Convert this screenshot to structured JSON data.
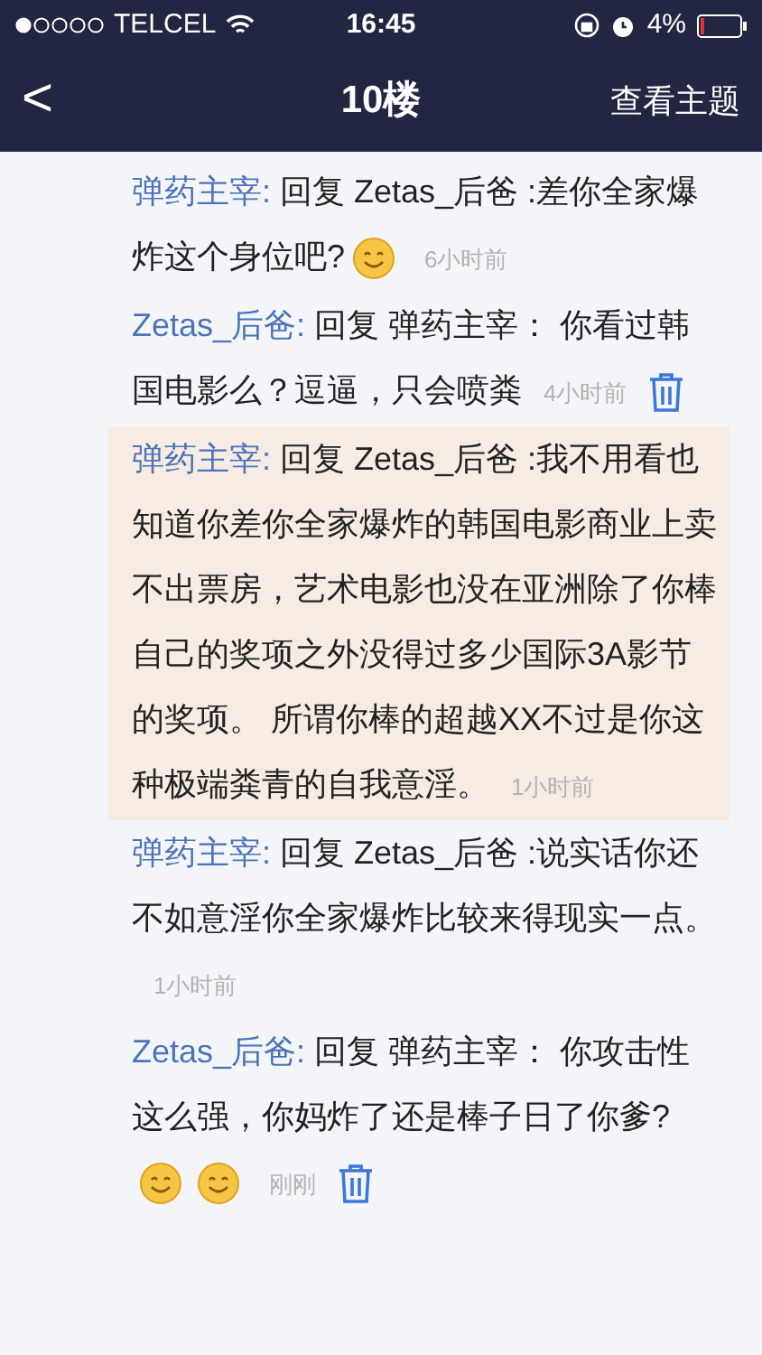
{
  "status_bar": {
    "carrier": "TELCEL",
    "time": "16:45",
    "battery": "4%"
  },
  "nav": {
    "back": "<",
    "title": "10楼",
    "action": "查看主题"
  },
  "comments": [
    {
      "author": "弹药主宰:",
      "text": "回复 Zetas_后爸 :差你全家爆炸这个身位吧?",
      "emojis": [
        {
          "kind": "smile"
        }
      ],
      "time": "6小时前",
      "deletable": false,
      "highlighted": false
    },
    {
      "author": "Zetas_后爸:",
      "text": "回复 弹药主宰： 你看过韩国电影么？逗逼，只会喷粪",
      "time": "4小时前",
      "deletable": true,
      "highlighted": false
    },
    {
      "author": "弹药主宰:",
      "text": "回复 Zetas_后爸 :我不用看也知道你差你全家爆炸的韩国电影商业上卖不出票房，艺术电影也没在亚洲除了你棒自己的奖项之外没得过多少国际3A影节的奖项。 所谓你棒的超越XX不过是你这种极端粪青的自我意淫。",
      "time": "1小时前",
      "deletable": false,
      "highlighted": true
    },
    {
      "author": "弹药主宰:",
      "text": "回复 Zetas_后爸 :说实话你还不如意淫你全家爆炸比较来得现实一点。",
      "time": "1小时前",
      "deletable": false,
      "highlighted": false
    },
    {
      "author": "Zetas_后爸:",
      "text": "回复 弹药主宰： 你攻击性这么强，你妈炸了还是棒子日了你爹?",
      "emojis": [
        {
          "kind": "smile"
        },
        {
          "kind": "smile"
        }
      ],
      "time": "刚刚",
      "deletable": true,
      "highlighted": false
    }
  ]
}
